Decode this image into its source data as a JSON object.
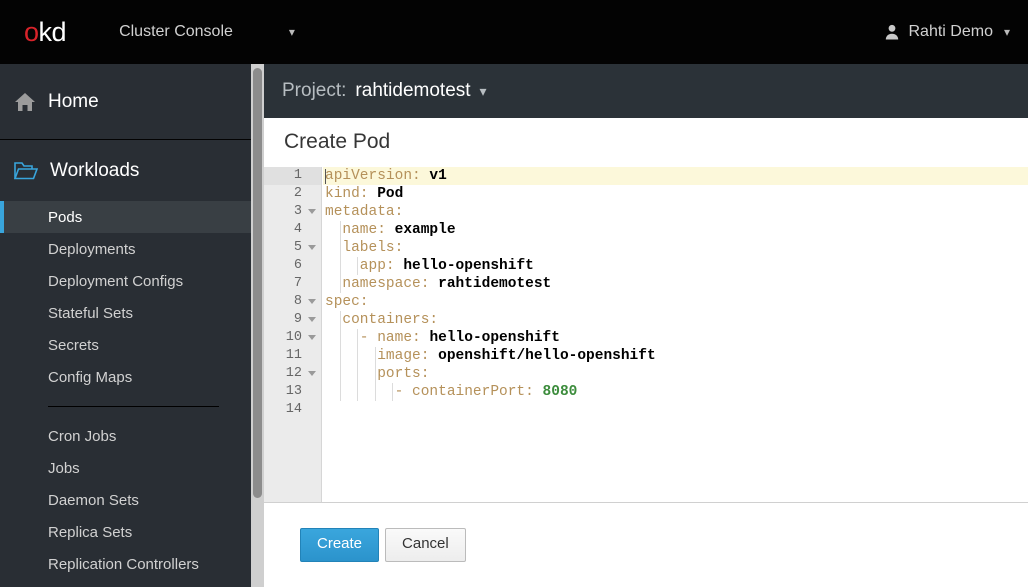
{
  "masthead": {
    "logo_o": "o",
    "logo_kd": "kd",
    "console_name": "Cluster Console",
    "console_caret": "chevron-down",
    "user_name": "Rahti Demo",
    "user_caret": "chevron-down"
  },
  "sidebar": {
    "home": {
      "label": "Home",
      "icon": "home-icon"
    },
    "workloads": {
      "label": "Workloads",
      "icon": "folder-icon"
    },
    "items": [
      {
        "label": "Pods",
        "active": true
      },
      {
        "label": "Deployments",
        "active": false
      },
      {
        "label": "Deployment Configs",
        "active": false
      },
      {
        "label": "Stateful Sets",
        "active": false
      },
      {
        "label": "Secrets",
        "active": false
      },
      {
        "label": "Config Maps",
        "active": false
      }
    ],
    "items2": [
      {
        "label": "Cron Jobs",
        "active": false
      },
      {
        "label": "Jobs",
        "active": false
      },
      {
        "label": "Daemon Sets",
        "active": false
      },
      {
        "label": "Replica Sets",
        "active": false
      },
      {
        "label": "Replication Controllers",
        "active": false
      }
    ]
  },
  "project_bar": {
    "label": "Project:",
    "name": "rahtidemotest",
    "caret": "chevron-down"
  },
  "page": {
    "title": "Create Pod"
  },
  "editor": {
    "active_line": 1,
    "total_lines": 14,
    "lines": [
      {
        "n": 1,
        "fold": false,
        "indent_guides": 0,
        "text": "apiVersion: v1"
      },
      {
        "n": 2,
        "fold": false,
        "indent_guides": 0,
        "text": "kind: Pod"
      },
      {
        "n": 3,
        "fold": true,
        "indent_guides": 0,
        "text": "metadata:"
      },
      {
        "n": 4,
        "fold": false,
        "indent_guides": 1,
        "text": "  name: example"
      },
      {
        "n": 5,
        "fold": true,
        "indent_guides": 1,
        "text": "  labels:"
      },
      {
        "n": 6,
        "fold": false,
        "indent_guides": 2,
        "text": "    app: hello-openshift"
      },
      {
        "n": 7,
        "fold": false,
        "indent_guides": 1,
        "text": "  namespace: rahtidemotest"
      },
      {
        "n": 8,
        "fold": true,
        "indent_guides": 0,
        "text": "spec:"
      },
      {
        "n": 9,
        "fold": true,
        "indent_guides": 1,
        "text": "  containers:"
      },
      {
        "n": 10,
        "fold": true,
        "indent_guides": 2,
        "text": "    - name: hello-openshift"
      },
      {
        "n": 11,
        "fold": false,
        "indent_guides": 3,
        "text": "      image: openshift/hello-openshift"
      },
      {
        "n": 12,
        "fold": true,
        "indent_guides": 3,
        "text": "      ports:"
      },
      {
        "n": 13,
        "fold": false,
        "indent_guides": 4,
        "text": "        - containerPort: 8080"
      },
      {
        "n": 14,
        "fold": false,
        "indent_guides": 0,
        "text": ""
      }
    ],
    "tokens": [
      {
        "n": 1,
        "parts": [
          {
            "t": "apiVersion:",
            "c": "k"
          },
          {
            "t": " ",
            "c": "p"
          },
          {
            "t": "v1",
            "c": "v"
          }
        ]
      },
      {
        "n": 2,
        "parts": [
          {
            "t": "kind:",
            "c": "k"
          },
          {
            "t": " ",
            "c": "p"
          },
          {
            "t": "Pod",
            "c": "v"
          }
        ]
      },
      {
        "n": 3,
        "parts": [
          {
            "t": "metadata:",
            "c": "k"
          }
        ]
      },
      {
        "n": 4,
        "parts": [
          {
            "t": "  name:",
            "c": "k"
          },
          {
            "t": " ",
            "c": "p"
          },
          {
            "t": "example",
            "c": "v"
          }
        ]
      },
      {
        "n": 5,
        "parts": [
          {
            "t": "  labels:",
            "c": "k"
          }
        ]
      },
      {
        "n": 6,
        "parts": [
          {
            "t": "    app:",
            "c": "k"
          },
          {
            "t": " ",
            "c": "p"
          },
          {
            "t": "hello-openshift",
            "c": "v"
          }
        ]
      },
      {
        "n": 7,
        "parts": [
          {
            "t": "  namespace:",
            "c": "k"
          },
          {
            "t": " ",
            "c": "p"
          },
          {
            "t": "rahtidemotest",
            "c": "v"
          }
        ]
      },
      {
        "n": 8,
        "parts": [
          {
            "t": "spec:",
            "c": "k"
          }
        ]
      },
      {
        "n": 9,
        "parts": [
          {
            "t": "  containers:",
            "c": "k"
          }
        ]
      },
      {
        "n": 10,
        "parts": [
          {
            "t": "    - ",
            "c": "d"
          },
          {
            "t": "name:",
            "c": "k"
          },
          {
            "t": " ",
            "c": "p"
          },
          {
            "t": "hello-openshift",
            "c": "v"
          }
        ]
      },
      {
        "n": 11,
        "parts": [
          {
            "t": "      image:",
            "c": "k"
          },
          {
            "t": " ",
            "c": "p"
          },
          {
            "t": "openshift/hello-openshift",
            "c": "v"
          }
        ]
      },
      {
        "n": 12,
        "parts": [
          {
            "t": "      ports:",
            "c": "k"
          }
        ]
      },
      {
        "n": 13,
        "parts": [
          {
            "t": "        - ",
            "c": "d"
          },
          {
            "t": "containerPort:",
            "c": "k"
          },
          {
            "t": " ",
            "c": "p"
          },
          {
            "t": "8080",
            "c": "n"
          }
        ]
      },
      {
        "n": 14,
        "parts": []
      }
    ]
  },
  "actions": {
    "create_label": "Create",
    "cancel_label": "Cancel"
  },
  "colors": {
    "accent_blue": "#39a5dc",
    "brand_red": "#d8232a",
    "sidebar_bg": "#292e34",
    "project_bar_bg": "#2b3238",
    "active_line": "#fcf8da",
    "yaml_key": "#b5915a",
    "yaml_number": "#3c8c3c"
  }
}
